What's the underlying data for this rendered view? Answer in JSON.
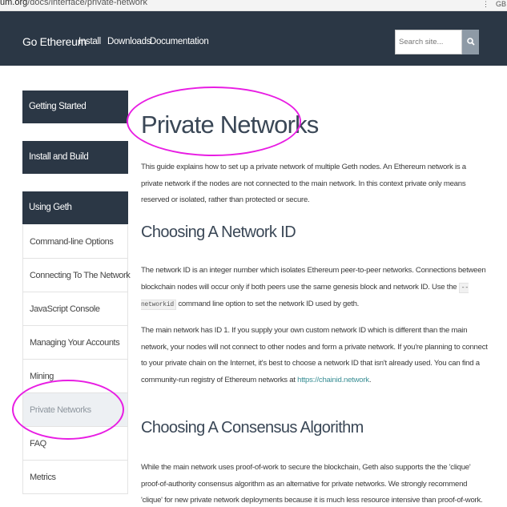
{
  "browser": {
    "url_prefix": "um.org",
    "url_path": "/docs/interface/private-network",
    "ic1": "⋮",
    "ic2": "GB"
  },
  "nav": {
    "brand": "Go Ethereum",
    "links": [
      "Install",
      "Downloads",
      "Documentation"
    ],
    "search_placeholder": "Search site...",
    "search_icon": "magnifier-icon"
  },
  "sidebar": {
    "sections": [
      "Getting Started",
      "Install and Build",
      "Using Geth"
    ],
    "items": [
      "Command-line Options",
      "Connecting To The Network",
      "JavaScript Console",
      "Managing Your Accounts",
      "Mining",
      "Private Networks",
      "FAQ",
      "Metrics"
    ],
    "active_item": "Private Networks"
  },
  "content": {
    "title": "Private Networks",
    "intro": "This guide explains how to set up a private network of multiple Geth nodes. An Ethereum network is a private network if the nodes are not connected to the main network. In this context private only means reserved or isolated, rather than protected or secure.",
    "h_network_id": "Choosing A Network ID",
    "p1_a": "The network ID is an integer number which isolates Ethereum peer-to-peer networks. Connections between blockchain nodes will occur only if both peers use the same genesis block and network ID. Use the ",
    "p1_code": "--networkid",
    "p1_b": " command line option to set the network ID used by geth.",
    "p2_a": "The main network has ID 1. If you supply your own custom network ID which is different than the main network, your nodes will not connect to other nodes and form a private network. If you're planning to connect to your private chain on the Internet, it's best to choose a network ID that isn't already used. You can find a community-run registry of Ethereum networks at ",
    "p2_link": "https://chainid.network",
    "p2_end": ".",
    "h_consensus": "Choosing A Consensus Algorithm",
    "p3": "While the main network uses proof-of-work to secure the blockchain, Geth also supports the the 'clique' proof-of-authority consensus algorithm as an alternative for private networks. We strongly recommend 'clique' for new private network deployments because it is much less resource intensive than proof-of-work. The clique system is also used for several public Ethereum testnets"
  },
  "colors": {
    "navbar": "#2b3745",
    "annotation": "#e81de3",
    "link": "#3a8f95"
  }
}
